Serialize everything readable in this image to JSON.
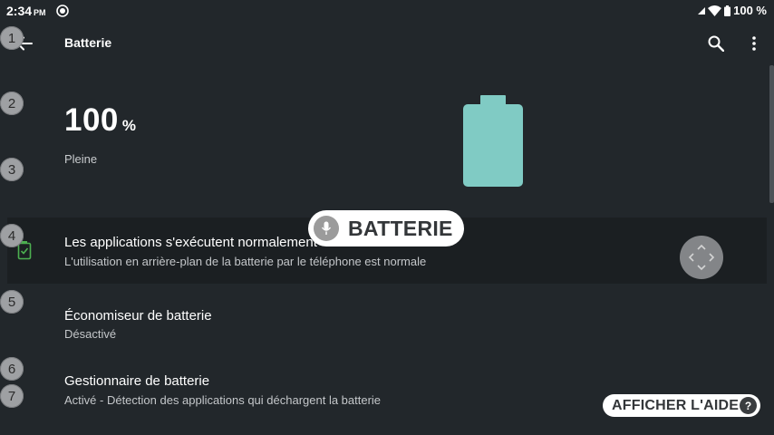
{
  "status_bar": {
    "time": "2:34",
    "ampm": "PM",
    "battery_level": "100 %",
    "icons": [
      "app-notification-icon",
      "wifi-icon",
      "signal-icon",
      "battery-icon"
    ]
  },
  "toolbar": {
    "title": "Batterie",
    "icons": [
      "back-arrow-icon",
      "search-icon",
      "more-vert-icon"
    ]
  },
  "battery": {
    "percent": "100",
    "percent_sign": "%",
    "state": "Pleine",
    "color": "#80cbc4",
    "fill": 1.0
  },
  "rows": {
    "apps": {
      "title": "Les applications s'exécutent normalement",
      "subtitle": "L'utilisation en arrière-plan de la batterie par le téléphone est normale",
      "icon": "battery-check-icon",
      "icon_color": "#4caf50"
    },
    "saver": {
      "title": "Économiseur de batterie",
      "subtitle": "Désactivé"
    },
    "manager": {
      "title": "Gestionnaire de batterie",
      "subtitle": "Activé - Détection des applications qui déchargent la batterie"
    }
  },
  "markers": [
    "1",
    "2",
    "3",
    "4",
    "5",
    "6",
    "7"
  ],
  "voice_command": {
    "label": "BATTERIE",
    "icon": "microphone-icon"
  },
  "help": {
    "label": "AFFICHER L'AIDE",
    "badge": "?"
  }
}
